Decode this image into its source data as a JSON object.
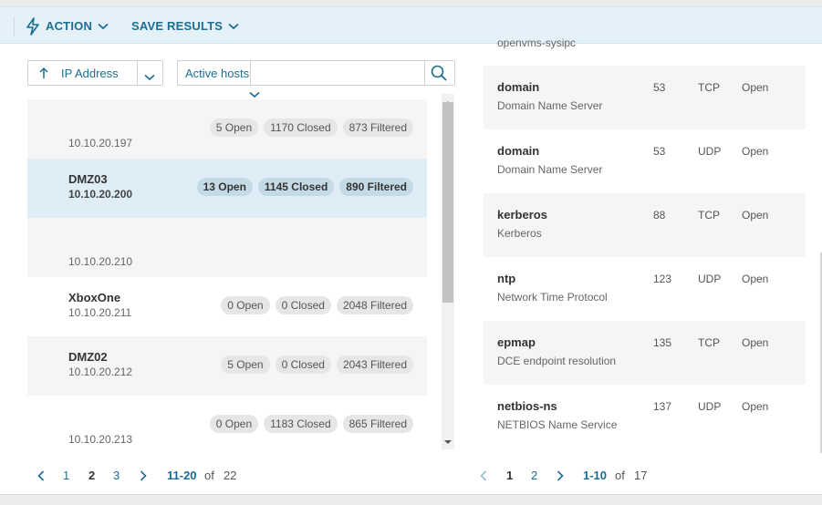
{
  "toolbar": {
    "action_label": "ACTION",
    "save_label": "SAVE RESULTS"
  },
  "sort": {
    "field": "IP Address"
  },
  "filter": {
    "label": "Active hosts",
    "query": "",
    "placeholder": ""
  },
  "hosts": [
    {
      "name": "",
      "ip": "10.10.20.197",
      "open": "5 Open",
      "closed": "1170 Closed",
      "filtered": "873 Filtered"
    },
    {
      "name": "DMZ03",
      "ip": "10.10.20.200",
      "open": "13 Open",
      "closed": "1145 Closed",
      "filtered": "890 Filtered"
    },
    {
      "name": "",
      "ip": "10.10.20.210",
      "open": "",
      "closed": "",
      "filtered": ""
    },
    {
      "name": "XboxOne",
      "ip": "10.10.20.211",
      "open": "0 Open",
      "closed": "0 Closed",
      "filtered": "2048 Filtered"
    },
    {
      "name": "DMZ02",
      "ip": "10.10.20.212",
      "open": "5 Open",
      "closed": "0 Closed",
      "filtered": "2043 Filtered"
    },
    {
      "name": "",
      "ip": "10.10.20.213",
      "open": "0 Open",
      "closed": "1183 Closed",
      "filtered": "865 Filtered"
    }
  ],
  "host_pager": {
    "pages": [
      "1",
      "2",
      "3"
    ],
    "current": "2",
    "range": "11-20",
    "of": "of",
    "total": "22"
  },
  "ports_top_text": "openvms-sysipc",
  "ports": [
    {
      "service": "domain",
      "description": "Domain Name Server",
      "port": "53",
      "protocol": "TCP",
      "state": "Open"
    },
    {
      "service": "domain",
      "description": "Domain Name Server",
      "port": "53",
      "protocol": "UDP",
      "state": "Open"
    },
    {
      "service": "kerberos",
      "description": "Kerberos",
      "port": "88",
      "protocol": "TCP",
      "state": "Open"
    },
    {
      "service": "ntp",
      "description": "Network Time Protocol",
      "port": "123",
      "protocol": "UDP",
      "state": "Open"
    },
    {
      "service": "epmap",
      "description": "DCE endpoint resolution",
      "port": "135",
      "protocol": "TCP",
      "state": "Open"
    },
    {
      "service": "netbios-ns",
      "description": "NETBIOS Name Service",
      "port": "137",
      "protocol": "UDP",
      "state": "Open"
    }
  ],
  "port_pager": {
    "pages": [
      "1",
      "2"
    ],
    "current": "1",
    "range": "1-10",
    "of": "of",
    "total": "17"
  },
  "colors": {
    "accent": "#1b6e93",
    "toolbar_bg": "#e4f1f8",
    "selected_row": "#dfeef6"
  }
}
